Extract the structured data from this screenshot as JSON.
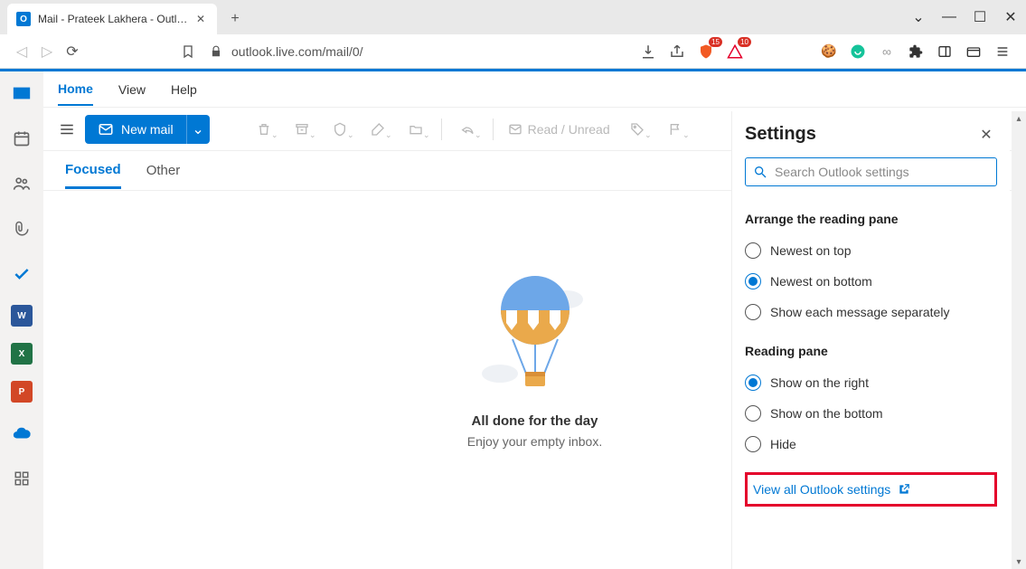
{
  "browser": {
    "tab_title": "Mail - Prateek Lakhera - Outlook",
    "url": "outlook.live.com/mail/0/",
    "badge1": "15",
    "badge2": "10"
  },
  "ribbon": {
    "tabs": [
      "Home",
      "View",
      "Help"
    ]
  },
  "toolbar": {
    "new_mail": "New mail",
    "read_unread": "Read / Unread"
  },
  "folder_tabs": {
    "focused": "Focused",
    "other": "Other"
  },
  "empty_state": {
    "title": "All done for the day",
    "subtitle": "Enjoy your empty inbox."
  },
  "settings": {
    "title": "Settings",
    "search_placeholder": "Search Outlook settings",
    "arrange_title": "Arrange the reading pane",
    "arrange_options": {
      "newest_top": "Newest on top",
      "newest_bottom": "Newest on bottom",
      "separate": "Show each message separately"
    },
    "reading_title": "Reading pane",
    "reading_options": {
      "right": "Show on the right",
      "bottom": "Show on the bottom",
      "hide": "Hide"
    },
    "view_all": "View all Outlook settings"
  }
}
